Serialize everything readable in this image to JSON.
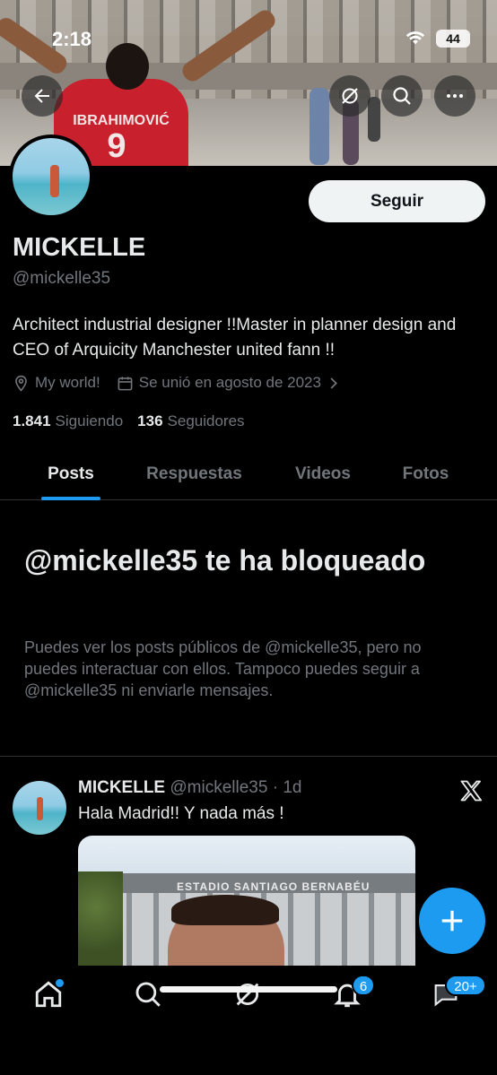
{
  "status_bar": {
    "time": "2:18",
    "battery": "44"
  },
  "banner": {
    "jersey_name": "IBRAHIMOVIĆ",
    "jersey_number": "9"
  },
  "profile": {
    "follow_label": "Seguir",
    "display_name": "MICKELLE",
    "handle": "@mickelle35",
    "bio": "Architect industrial designer !!Master in planner design and CEO of Arquicity Manchester united fann !!",
    "location": "My world!",
    "joined": "Se unió en agosto de 2023",
    "following_count": "1.841",
    "following_label": "Siguiendo",
    "followers_count": "136",
    "followers_label": "Seguidores"
  },
  "tabs": [
    {
      "label": "Posts",
      "active": true
    },
    {
      "label": "Respuestas",
      "active": false
    },
    {
      "label": "Videos",
      "active": false
    },
    {
      "label": "Fotos",
      "active": false
    }
  ],
  "blocked": {
    "title": "@mickelle35 te ha bloqueado",
    "text": "Puedes ver los posts públicos de @mickelle35, pero no puedes interactuar con ellos. Tampoco puedes seguir a @mickelle35 ni enviarle mensajes."
  },
  "post": {
    "author": "MICKELLE",
    "handle_time": "@mickelle35 · 1d",
    "text": "Hala Madrid!! Y nada más !",
    "media_caption": "ESTADIO SANTIAGO BERNABÉU"
  },
  "bottom_nav": {
    "notifications_badge": "6",
    "messages_badge": "20+"
  },
  "colors": {
    "accent": "#1d9bf0",
    "background": "#000000",
    "muted": "#71767b"
  }
}
